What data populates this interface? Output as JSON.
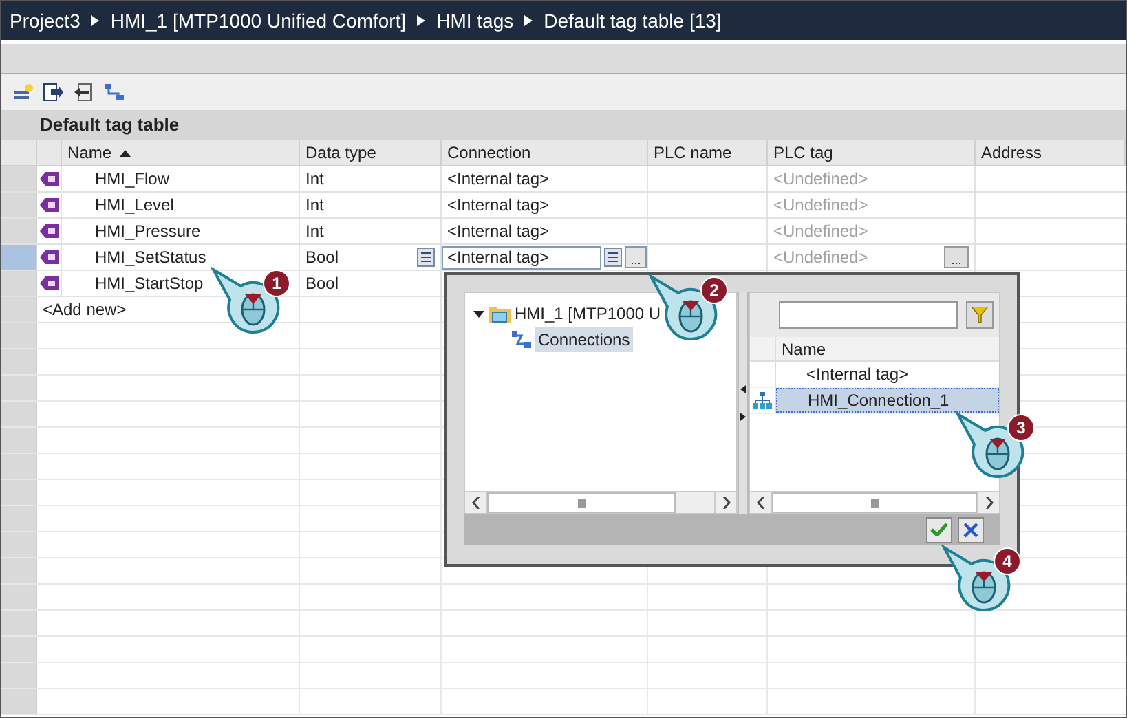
{
  "breadcrumb": [
    "Project3",
    "HMI_1 [MTP1000 Unified Comfort]",
    "HMI tags",
    "Default tag table [13]"
  ],
  "table": {
    "title": "Default tag table",
    "columns": [
      {
        "label": "Name",
        "sorted": true
      },
      {
        "label": "Data type",
        "sorted": false
      },
      {
        "label": "Connection",
        "sorted": false
      },
      {
        "label": "PLC name",
        "sorted": false
      },
      {
        "label": "PLC tag",
        "sorted": false
      },
      {
        "label": "Address",
        "sorted": false
      }
    ],
    "rows": [
      {
        "name": "HMI_Flow",
        "data_type": "Int",
        "connection": "<Internal tag>",
        "plc_tag": "<Undefined>",
        "selected": false
      },
      {
        "name": "HMI_Level",
        "data_type": "Int",
        "connection": "<Internal tag>",
        "plc_tag": "<Undefined>",
        "selected": false
      },
      {
        "name": "HMI_Pressure",
        "data_type": "Int",
        "connection": "<Internal tag>",
        "plc_tag": "<Undefined>",
        "selected": false
      },
      {
        "name": "HMI_SetStatus",
        "data_type": "Bool",
        "connection": "<Internal tag>",
        "plc_tag": "<Undefined>",
        "selected": true
      },
      {
        "name": "HMI_StartStop",
        "data_type": "Bool",
        "selected": false
      }
    ],
    "add_new": "<Add new>"
  },
  "dialog": {
    "tree": {
      "label": "HMI_1 [MTP1000 U",
      "expanded": true,
      "children": [
        {
          "label": "Connections",
          "selected": true
        }
      ]
    },
    "list_column": "Name",
    "items": [
      {
        "name": "<Internal tag>",
        "kind": "internal",
        "selected": false
      },
      {
        "name": "HMI_Connection_1",
        "kind": "connection",
        "selected": true
      }
    ]
  },
  "ellipsis": "...",
  "callouts": [
    "1",
    "2",
    "3",
    "4"
  ]
}
